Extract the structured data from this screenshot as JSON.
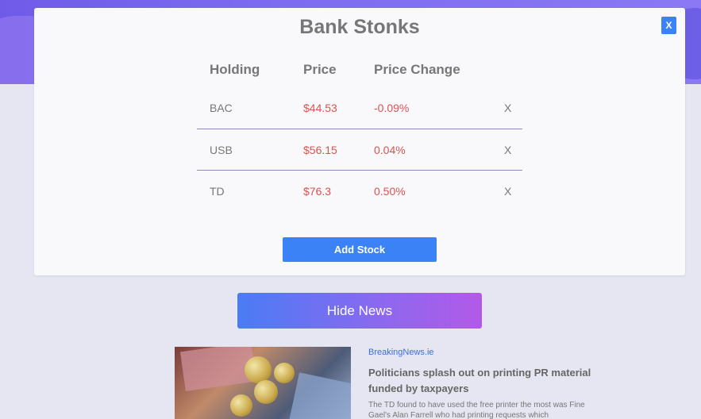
{
  "modal": {
    "title": "Bank Stonks",
    "close_label": "X",
    "table": {
      "headers": [
        "Holding",
        "Price",
        "Price Change"
      ],
      "rows": [
        {
          "holding": "BAC",
          "price": "$44.53",
          "change": "-0.09%",
          "remove": "X"
        },
        {
          "holding": "USB",
          "price": "$56.15",
          "change": "0.04%",
          "remove": "X"
        },
        {
          "holding": "TD",
          "price": "$76.3",
          "change": "0.50%",
          "remove": "X"
        }
      ]
    },
    "add_stock_label": "Add Stock"
  },
  "news": {
    "toggle_label": "Hide News",
    "articles": [
      {
        "source": "BreakingNews.ie",
        "headline": "Politicians splash out on printing PR material funded by taxpayers",
        "summary": "The TD found to have used the free printer the most was Fine Gael's Alan Farrell who had printing requests which"
      }
    ]
  },
  "colors": {
    "accent": "#3b82f6",
    "negative": "#d9534f",
    "source_link": "#3b6fd4",
    "gradient_start": "#4a7cf5",
    "gradient_end": "#b25ae8"
  }
}
